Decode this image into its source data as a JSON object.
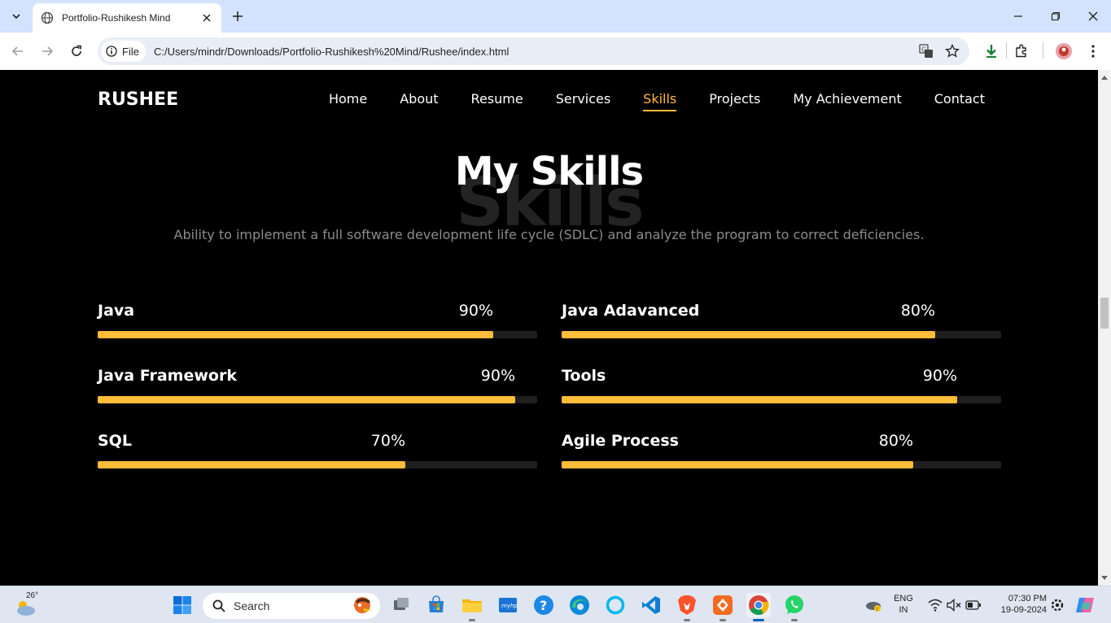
{
  "browser": {
    "tab_title": "Portfolio-Rushikesh Mind",
    "omnibox_chip": "File",
    "url": "C:/Users/mindr/Downloads/Portfolio-Rushikesh%20Mind/Rushee/index.html"
  },
  "site": {
    "logo": "RUSHEE",
    "nav": [
      "Home",
      "About",
      "Resume",
      "Services",
      "Skills",
      "Projects",
      "My Achievement",
      "Contact"
    ],
    "active_nav": "Skills",
    "accent_color": "#ffbd39"
  },
  "section": {
    "background_word": "Skills",
    "heading": "My Skills",
    "subtitle": "Ability to implement a full software development life cycle (SDLC) and analyze the program to correct deficiencies."
  },
  "skills": [
    {
      "name": "Java",
      "percent_label": "90%",
      "level": 0.9
    },
    {
      "name": "Java Adavanced",
      "percent_label": "80%",
      "level": 0.85
    },
    {
      "name": "Java Framework",
      "percent_label": "90%",
      "level": 0.95
    },
    {
      "name": "Tools",
      "percent_label": "90%",
      "level": 0.9
    },
    {
      "name": "SQL",
      "percent_label": "70%",
      "level": 0.7
    },
    {
      "name": "Agile Process",
      "percent_label": "80%",
      "level": 0.8
    }
  ],
  "taskbar": {
    "weather_temp": "26°",
    "search_placeholder": "Search",
    "language": "ENG",
    "region": "IN",
    "time": "07:30 PM",
    "date": "19-09-2024",
    "apps": [
      "windows-start-icon",
      "task-view-icon",
      "microsoft-store-icon",
      "file-explorer-icon",
      "myhp-icon",
      "help-icon",
      "edge-icon",
      "cortana-icon",
      "vscode-icon",
      "brave-icon",
      "app-icon",
      "chrome-icon",
      "whatsapp-icon"
    ]
  }
}
